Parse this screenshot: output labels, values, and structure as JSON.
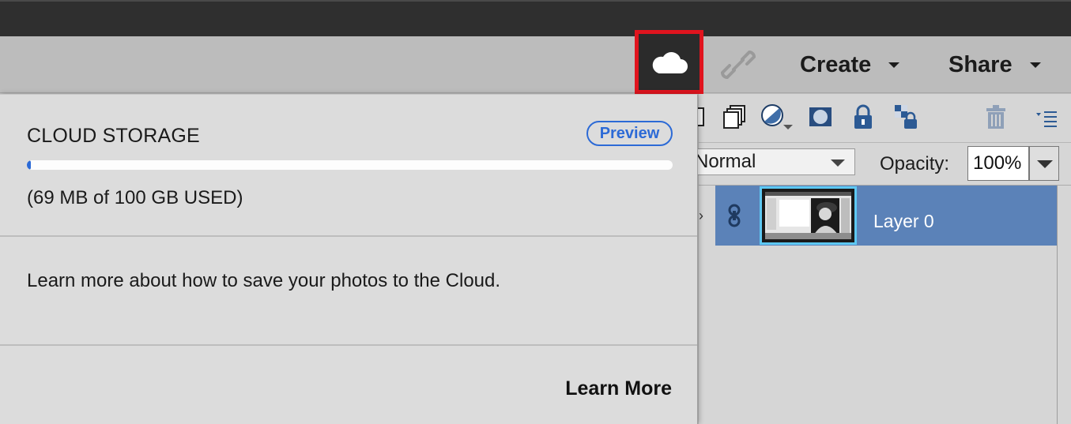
{
  "header": {
    "cloud_icon": "cloud-icon",
    "link_icon": "link-icon",
    "create_label": "Create",
    "share_label": "Share"
  },
  "cloud_popover": {
    "title": "CLOUD STORAGE",
    "badge": "Preview",
    "usage_text": "(69 MB of 100 GB USED)",
    "usage_fraction": 0.00069,
    "info_text": "Learn more about how to save your photos to the Cloud.",
    "learn_more_label": "Learn More"
  },
  "layers_panel": {
    "toolbar_icons": [
      "new-layer-icon",
      "duplicate-layer-icon",
      "adjustment-layer-icon",
      "layer-mask-icon",
      "lock-icon",
      "lock-transparency-icon",
      "trash-icon",
      "panel-menu-icon"
    ],
    "blend_mode": "Normal",
    "opacity_label": "Opacity:",
    "opacity_value": "100%",
    "layers": [
      {
        "name": "Layer 0",
        "selected": true
      }
    ]
  },
  "colors": {
    "highlight_border": "#e0141e",
    "accent_blue": "#2c6ad6",
    "selected_layer": "#5b82b8",
    "thumbnail_border": "#5ec8f2"
  }
}
